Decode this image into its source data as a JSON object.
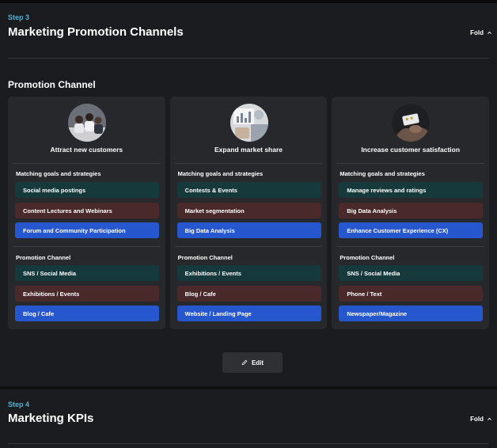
{
  "step3": {
    "step_label": "Step 3",
    "title": "Marketing Promotion Channels",
    "fold_label": "Fold",
    "subtitle": "Promotion Channel",
    "cards": [
      {
        "title": "Attract new customers",
        "goals_label": "Matching goals and strategies",
        "goals": [
          "Social media postings",
          "Content Lectures and Webinars",
          "Forum and Community Participation"
        ],
        "channels_label": "Promotion Channel",
        "channels": [
          "SNS / Social Media",
          "Exhibitions / Events",
          "Blog / Cafe"
        ]
      },
      {
        "title": "Expand market share",
        "goals_label": "Matching goals and strategies",
        "goals": [
          "Contests & Events",
          "Market segmentation",
          "Big Data Analysis"
        ],
        "channels_label": "Promotion Channel",
        "channels": [
          "Exhibitions / Events",
          "Blog / Cafe",
          "Website / Landing Page"
        ]
      },
      {
        "title": "Increase customer satisfaction",
        "goals_label": "Matching goals and strategies",
        "goals": [
          "Manage reviews and ratings",
          "Big Data Analysis",
          "Enhance Customer Experience (CX)"
        ],
        "channels_label": "Promotion Channel",
        "channels": [
          "SNS / Social Media",
          "Phone / Text",
          "Newspaper/Magazine"
        ]
      }
    ],
    "edit_label": "Edit"
  },
  "step4": {
    "step_label": "Step 4",
    "title": "Marketing KPIs",
    "fold_label": "Fold"
  },
  "colors": {
    "accent_step": "#4cb3d6",
    "chip_teal": "#16393c",
    "chip_maroon": "#4a292b",
    "chip_blue": "#2757cf"
  },
  "icons": [
    "chevron-up-icon",
    "pencil-icon"
  ]
}
